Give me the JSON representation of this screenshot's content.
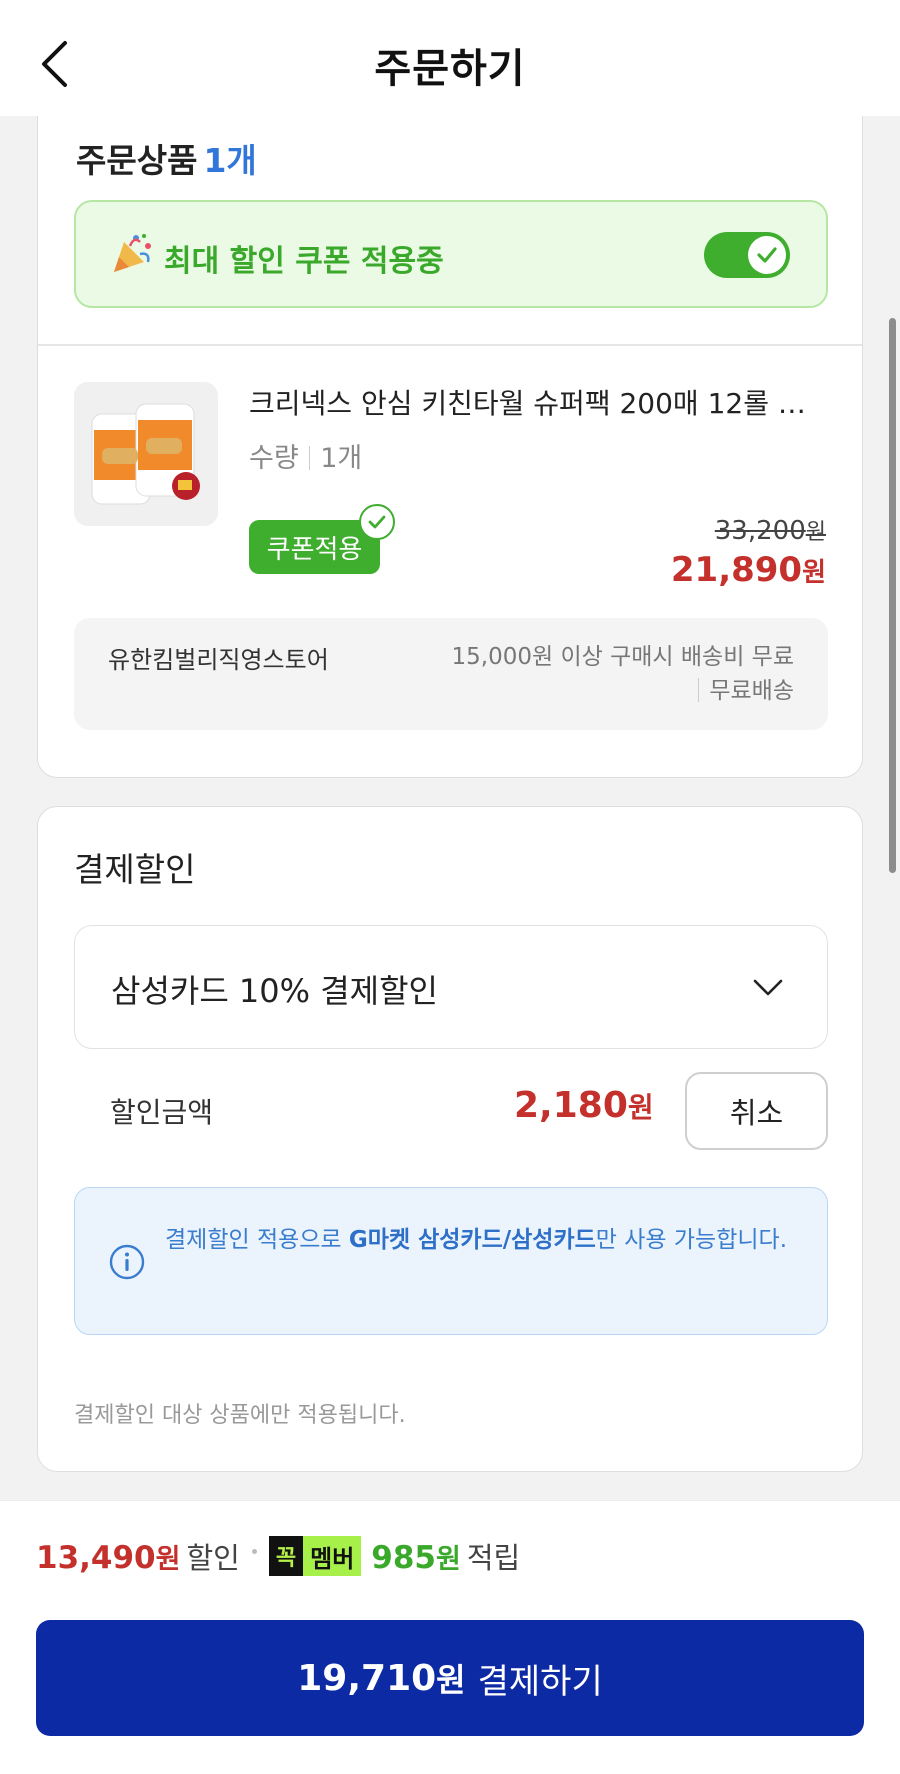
{
  "header": {
    "title": "주문하기",
    "back_icon": "chevron-left-icon"
  },
  "order_items": {
    "title": "주문상품",
    "count": "1개",
    "coupon_banner": {
      "text": "최대 할인 쿠폰 적용중",
      "toggle_on": true
    },
    "product": {
      "name": "크리넥스 안심 키친타월 슈퍼팩 200매 12롤 …",
      "qty_label": "수량",
      "qty_value": "1개",
      "coupon_tag": "쿠폰적용",
      "original_price": "33,200",
      "sale_price": "21,890",
      "won": "원"
    },
    "store": {
      "name": "유한킴벌리직영스토어",
      "shipping_condition": "15,000원 이상 구매시 배송비 무료",
      "shipping_fee": "무료배송"
    }
  },
  "payment_discount": {
    "title": "결제할인",
    "selected_card": "삼성카드 10% 결제할인",
    "discount_label": "할인금액",
    "discount_amount": "2,180",
    "won": "원",
    "cancel_label": "취소",
    "info_prefix": "결제할인 적용으로 ",
    "info_bold": "G마켓 삼성카드/삼성카드",
    "info_suffix": "만 사용 가능합니다.",
    "footnote": "결제할인 대상 상품에만 적용됩니다."
  },
  "bottom_bar": {
    "discount_total": "13,490",
    "won": "원",
    "discount_word": "할인",
    "member_badge_k": "꼭",
    "member_badge_text": "멤버",
    "points": "985",
    "points_word": "적립",
    "pay_amount": "19,710",
    "pay_label": "결제하기"
  },
  "colors": {
    "accent_blue": "#0d2aa5",
    "price_red": "#c4302b",
    "coupon_green": "#3fae2e",
    "count_blue": "#3176d8"
  }
}
